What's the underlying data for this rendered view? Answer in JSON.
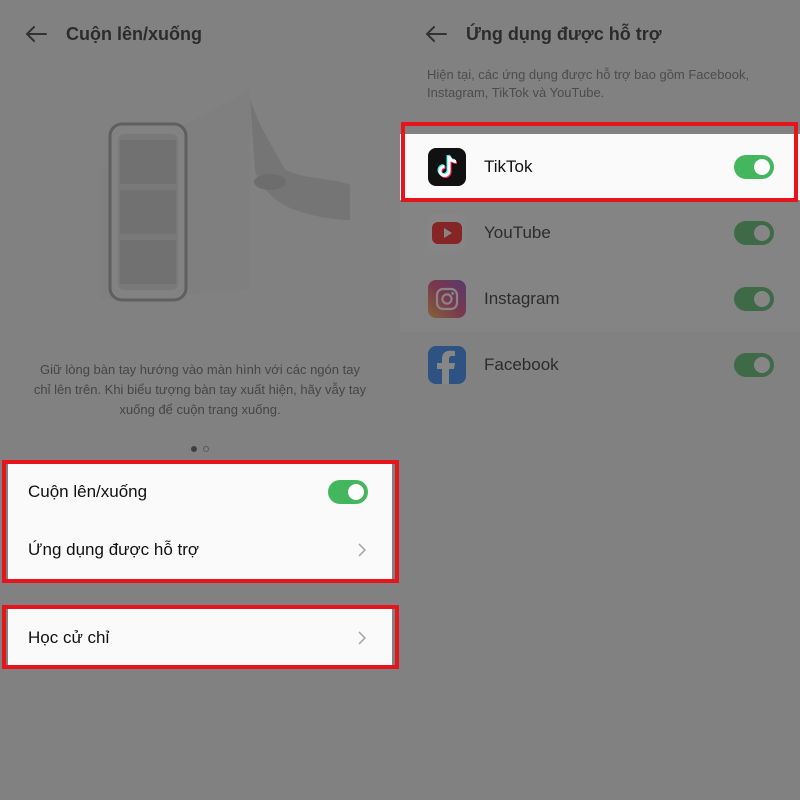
{
  "left": {
    "title": "Cuộn lên/xuống",
    "description": "Giữ lòng bàn tay hướng vào màn hình với các ngón tay chỉ lên trên. Khi biểu tượng bàn tay xuất hiện, hãy vẫy tay xuống để cuộn trang xuống.",
    "settings": [
      {
        "label": "Cuộn lên/xuống",
        "enabled": true
      },
      {
        "label": "Ứng dụng được hỗ trợ"
      }
    ],
    "gesture_learn": {
      "label": "Học cử chỉ"
    }
  },
  "right": {
    "title": "Ứng dụng được hỗ trợ",
    "description": "Hiện tại, các ứng dụng được hỗ trợ bao gồm Facebook, Instagram, TikTok và YouTube.",
    "apps": [
      {
        "name": "TikTok",
        "icon": "tiktok-icon",
        "enabled": true
      },
      {
        "name": "YouTube",
        "icon": "youtube-icon",
        "enabled": true
      },
      {
        "name": "Instagram",
        "icon": "instagram-icon",
        "enabled": true
      },
      {
        "name": "Facebook",
        "icon": "facebook-icon",
        "enabled": true
      }
    ]
  },
  "colors": {
    "toggle_on": "#43b65e",
    "highlight": "#e8141b"
  }
}
